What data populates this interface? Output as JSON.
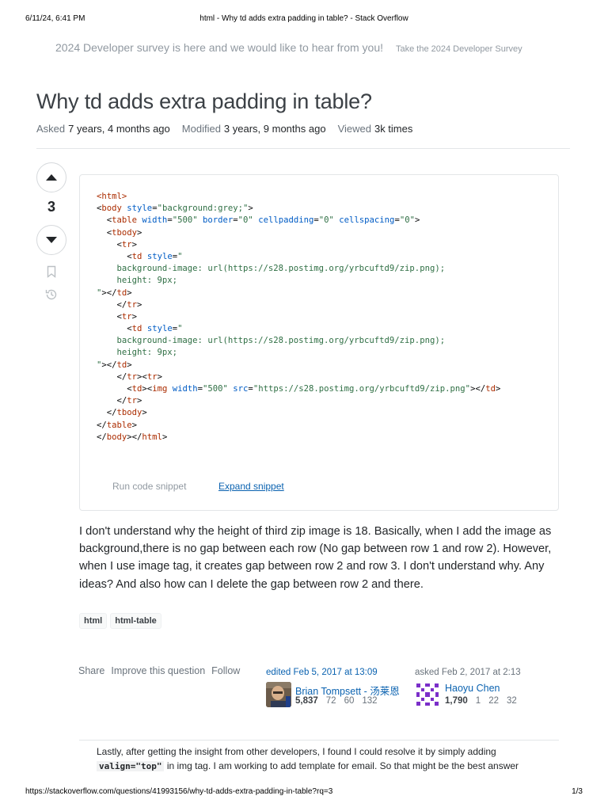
{
  "print_header": {
    "date": "6/11/24, 6:41 PM",
    "title": "html - Why td adds extra padding in table? - Stack Overflow"
  },
  "banner": {
    "text": "2024 Developer survey is here and we would like to hear from you!",
    "link": "Take the 2024 Developer Survey"
  },
  "question": {
    "title": "Why td adds extra padding in table?",
    "meta": [
      {
        "label": "Asked",
        "value": "7 years, 4 months ago"
      },
      {
        "label": "Modified",
        "value": "3 years, 9 months ago"
      },
      {
        "label": "Viewed",
        "value": "3k times"
      }
    ],
    "votes": "3",
    "icons": {
      "vote_up": "arrow-up",
      "vote_down": "arrow-down",
      "bookmark": "bookmark",
      "history": "history"
    },
    "snippet": {
      "lines": [
        [
          "<",
          "html",
          ">"
        ],
        [
          "<",
          "body",
          " ",
          "style=\"background:grey;\"",
          ">"
        ]
      ],
      "line_texts": [
        "<html>",
        "<body style=\"background:grey;\">",
        "  <table width=\"500\" border=\"0\" cellpadding=\"0\" cellspacing=\"0\">",
        "  <tbody>",
        "    <tr>",
        "      <td style=\"",
        "    background-image: url(https://s28.postimg.org/yrbcuftd9/zip.png);",
        "    height: 9px;",
        "\"></td>",
        "    </tr>",
        "    <tr>",
        "      <td style=\"",
        "    background-image: url(https://s28.postimg.org/yrbcuftd9/zip.png);",
        "    height: 9px;",
        "\"></td>",
        "    </tr><tr>",
        "      <td><img width=\"500\" src=\"https://s28.postimg.org/yrbcuftd9/zip.png\"></td>",
        "    </tr>",
        "  </tbody>",
        "</table>",
        "</body></html>"
      ],
      "run_label": "Run code snippet",
      "expand_label": "Expand snippet"
    },
    "body": "I don't understand why the height of third zip image is 18. Basically, when I add the image as background,there is no gap between each row (No gap between row 1 and row 2). However, when I use image tag, it creates gap between row 2 and row 3. I don't understand why. Any ideas? And also how can I delete the gap between row 2 and there.",
    "tags": [
      "html",
      "html-table"
    ],
    "post_menu": [
      "Share",
      "Improve this question",
      "Follow"
    ],
    "edited": {
      "label": "edited Feb 5, 2017 at 13:09",
      "user": "Brian Tompsett - 汤莱恩",
      "reputation": "5,837",
      "badges": [
        "72",
        "60",
        "132"
      ]
    },
    "asked": {
      "label": "asked Feb 2, 2017 at 2:13",
      "user": "Haoyu Chen",
      "reputation": "1,790",
      "badges": [
        "1",
        "22",
        "32"
      ]
    }
  },
  "comment": {
    "text_before": "Lastly, after getting the insight from other developers, I found I could resolve it by simply adding",
    "code": "valign=\"top\"",
    "text_after": " in img tag. I am working to add template for email. So that might be the best answer"
  },
  "print_footer": {
    "url": "https://stackoverflow.com/questions/41993156/why-td-adds-extra-padding-in-table?rq=3",
    "pages": "1/3"
  },
  "colors": {
    "link": "#0a62b0",
    "muted": "#6a737c",
    "tag_name": "#ab2c00",
    "attr_name": "#005cc5",
    "attr_value": "#2f6f44"
  }
}
